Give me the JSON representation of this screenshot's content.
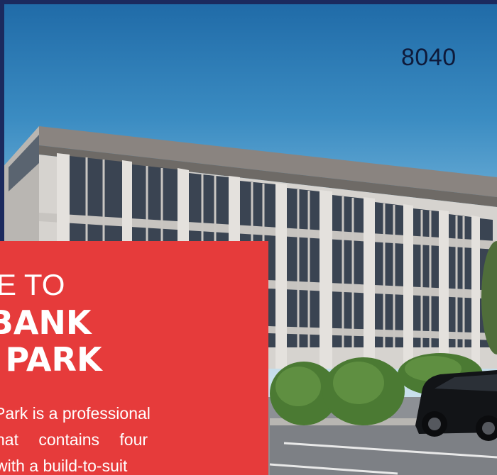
{
  "hero": {
    "address_number": "8040",
    "title_line1": "ME TO",
    "title_line2": "C BANK",
    "title_line3": "E PARK",
    "body_line1": "Park is a professional",
    "body_line2": "hat contains four",
    "body_line3": "with a build-to-suit"
  },
  "colors": {
    "panel_red": "#e63b3b",
    "frame_navy": "#1b2a5e",
    "sky_blue": "#3b8cc2"
  }
}
